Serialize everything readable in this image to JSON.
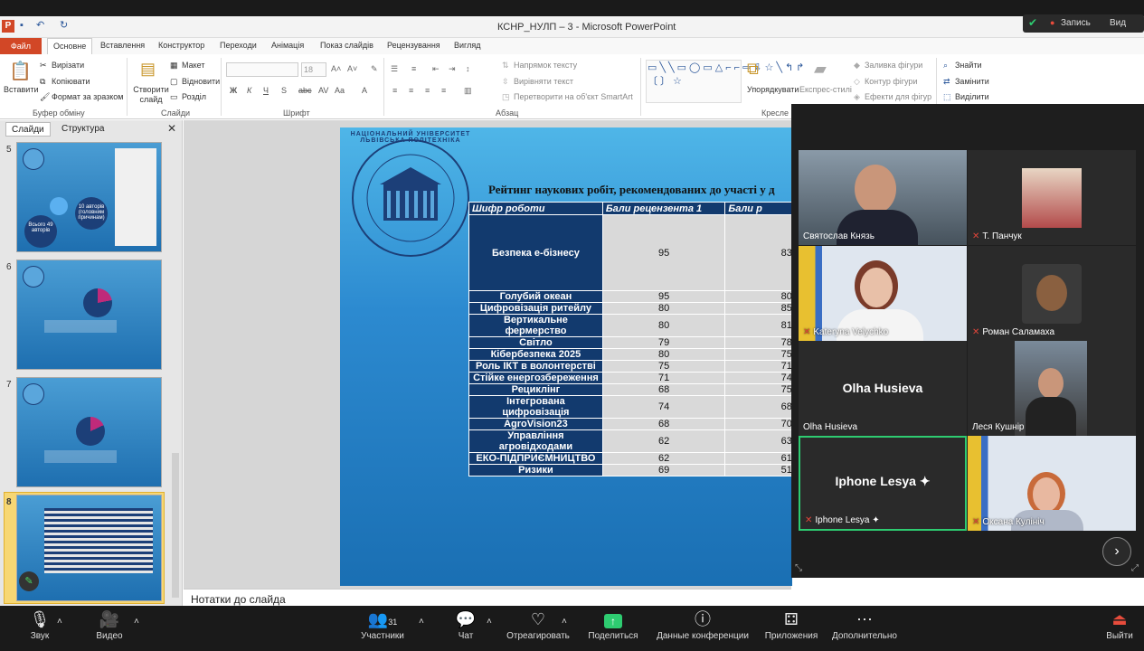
{
  "titlebar": {
    "title": "КСНР_НУЛП – 3 - Microsoft PowerPoint",
    "record": "Запись",
    "view": "Вид"
  },
  "tabs": [
    "Файл",
    "Основне",
    "Вставлення",
    "Конструктор",
    "Переходи",
    "Анімація",
    "Показ слайдів",
    "Рецензування",
    "Вигляд"
  ],
  "ribbon": {
    "paste": "Вставити",
    "cut": "Вирізати",
    "copy": "Копіювати",
    "format": "Формат за зразком",
    "new_slide": "Створити слайд",
    "layout": "Макет",
    "reset": "Відновити",
    "section": "Розділ",
    "font_size": "18",
    "text_direction": "Напрямок тексту",
    "align_text": "Вирівняти текст",
    "smartart": "Перетворити на об'єкт SmartArt",
    "arrange": "Упорядкувати",
    "quick_styles": "Експрес-стилі",
    "fill": "Заливка фігури",
    "outline": "Контур фігури",
    "effects": "Ефекти для фігур",
    "find": "Знайти",
    "replace": "Замінити",
    "select": "Виділити",
    "groups": {
      "clipboard": "Буфер обміну",
      "slides": "Слайди",
      "font": "Шрифт",
      "paragraph": "Абзац",
      "drawing": "Кресле"
    }
  },
  "leftpanel": {
    "tab_slides": "Слайди",
    "tab_outline": "Структура",
    "slide_numbers": [
      "5",
      "6",
      "7",
      "8"
    ],
    "thumb5_a": "Всього 49 авторів",
    "thumb5_b": "10 авторів (головним причинам)"
  },
  "slide": {
    "university": "НАЦІОНАЛЬНИЙ УНІВЕРСИТЕТ ЛЬВІВСЬКА ПОЛІТЕХНІКА",
    "title": "Рейтинг наукових робіт, рекомендованих до участі у д",
    "headers": [
      "Шифр роботи",
      "Бали рецензента 1",
      "Бали р"
    ],
    "rows": [
      [
        "Безпека е-бізнесу",
        "95",
        "83"
      ],
      [
        "Голубий океан",
        "95",
        "80"
      ],
      [
        "Цифровізація ритейлу",
        "80",
        "85"
      ],
      [
        "Вертикальне фермерство",
        "80",
        "81"
      ],
      [
        "Світло",
        "79",
        "78"
      ],
      [
        "Кібербезпека 2025",
        "80",
        "75"
      ],
      [
        "Роль ІКТ  в волонтерстві",
        "75",
        "71"
      ],
      [
        "Стійке енергозбереження",
        "71",
        "74"
      ],
      [
        "Рециклінг",
        "68",
        "75"
      ],
      [
        "Інтегрована цифровізація",
        "74",
        "68"
      ],
      [
        "AgroVision23",
        "68",
        "70"
      ],
      [
        "Управління агровідходами",
        "62",
        "63"
      ],
      [
        "ЕКО-ПІДПРИЄМНИЦТВО",
        "62",
        "61"
      ],
      [
        "Ризики",
        "69",
        "51"
      ]
    ]
  },
  "notes": "Нотатки до слайда",
  "participants": [
    {
      "name": "Святослав Князь"
    },
    {
      "name": "Т. Панчук"
    },
    {
      "name": "Kateryna Velychko"
    },
    {
      "name": "Роман Саламаха"
    },
    {
      "name": "Olha Husieva",
      "big": "Olha Husieva"
    },
    {
      "name": "Леся Кушнір"
    },
    {
      "name": "Iphone  Lesya",
      "big": "Iphone  Lesya"
    },
    {
      "name": "Оксана Кулініч"
    }
  ],
  "bottombar": {
    "audio": "Звук",
    "video": "Видео",
    "participants": "Участники",
    "participants_count": "31",
    "chat": "Чат",
    "react": "Отреагировать",
    "share": "Поделиться",
    "info": "Данные конференции",
    "apps": "Приложения",
    "more": "Дополнительно",
    "leave": "Выйти"
  }
}
